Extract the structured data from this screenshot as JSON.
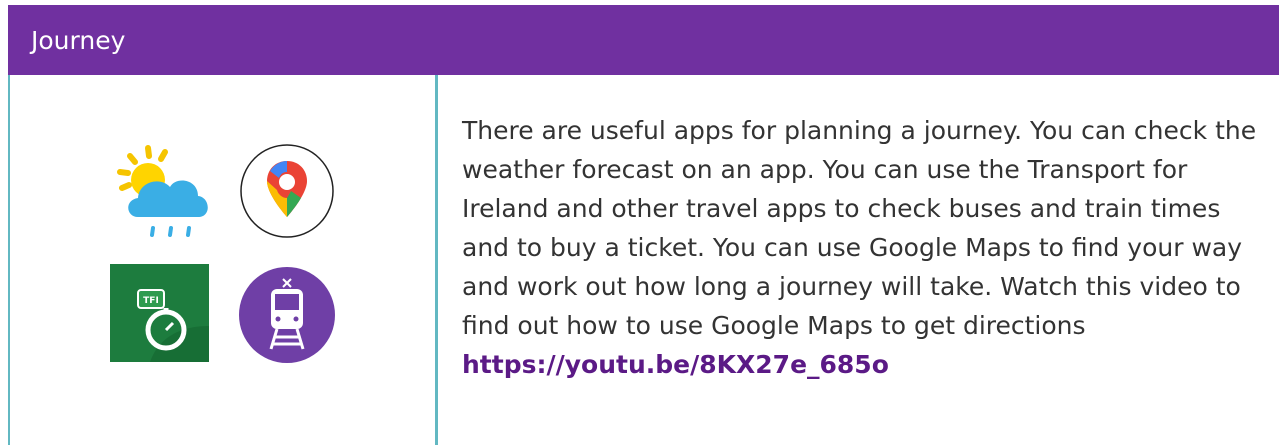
{
  "section": {
    "title": "Journey"
  },
  "icons": {
    "weather": "weather-rain-sun-icon",
    "maps": "google-maps-pin-icon",
    "tfi": "tfi-journey-planner-icon",
    "train": "train-app-icon",
    "tfi_label": "TFI"
  },
  "content": {
    "paragraph": "There are useful apps for planning a journey. You can check the weather forecast on an app. You can use the Transport for Ireland and other travel apps to check buses and train times and to buy a ticket. You can use Google Maps to find your way and work out how long a journey will take. Watch this video to find out how to use Google Maps to get directions",
    "link": "https://youtu.be/8KX27e_685o"
  },
  "colors": {
    "header_bg": "#7030a0",
    "border": "#62b8c2",
    "link": "#5b1a86"
  }
}
